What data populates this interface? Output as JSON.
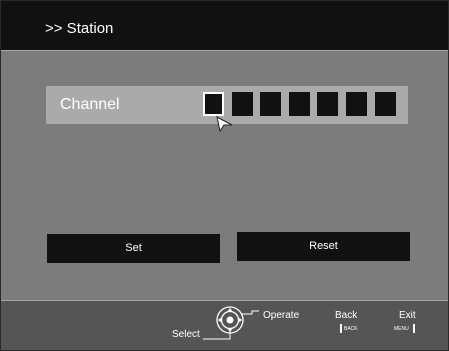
{
  "header": {
    "title": ">> Station"
  },
  "channel": {
    "label": "Channel",
    "digits": [
      "",
      "",
      "",
      "",
      "",
      "",
      ""
    ],
    "active_index": 0
  },
  "buttons": {
    "set_label": "Set",
    "reset_label": "Reset"
  },
  "footer": {
    "select_label": "Select",
    "operate_label": "Operate",
    "back_label": "Back",
    "back_key": "BACK",
    "exit_label": "Exit",
    "exit_key": "MENU"
  },
  "icons": {
    "navigation": "dpad-icon",
    "cursor": "pointer-cursor-icon"
  },
  "colors": {
    "background": "#7c7c7c",
    "bar": "#111111",
    "channel_row": "#aaaaaa",
    "footer": "#555555",
    "text": "#ffffff"
  }
}
